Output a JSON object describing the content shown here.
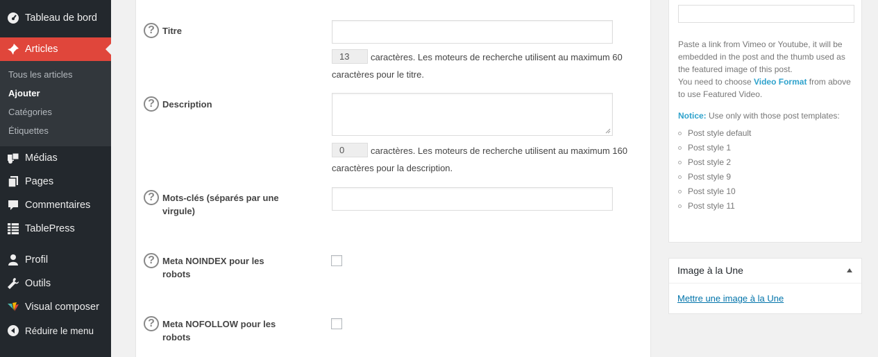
{
  "sidebar": {
    "menu": [
      {
        "label": "Tableau de bord",
        "icon": "dashboard-icon"
      },
      {
        "label": "Articles",
        "icon": "pushpin-icon"
      },
      {
        "label": "Médias",
        "icon": "media-icon"
      },
      {
        "label": "Pages",
        "icon": "pages-icon"
      },
      {
        "label": "Commentaires",
        "icon": "comment-icon"
      },
      {
        "label": "TablePress",
        "icon": "table-icon"
      },
      {
        "label": "Profil",
        "icon": "user-icon"
      },
      {
        "label": "Outils",
        "icon": "wrench-icon"
      },
      {
        "label": "Visual composer",
        "icon": "visual-composer-icon"
      }
    ],
    "submenu": [
      "Tous les articles",
      "Ajouter",
      "Catégories",
      "Étiquettes"
    ],
    "collapse_label": "Réduire le menu"
  },
  "seo": {
    "title": {
      "label": "Titre",
      "value": "",
      "count": "13",
      "help": "caractères. Les moteurs de recherche utilisent au maximum 60 caractères pour le titre."
    },
    "description": {
      "label": "Description",
      "value": "",
      "count": "0",
      "help": "caractères. Les moteurs de recherche utilisent au maximum 160 caractères pour la description."
    },
    "keywords": {
      "label": "Mots-clés (séparés par une virgule)",
      "value": ""
    },
    "noindex": {
      "label": "Meta NOINDEX pour les robots",
      "checked": false
    },
    "nofollow": {
      "label": "Meta NOFOLLOW pour les robots",
      "checked": false
    },
    "help_glyph": "?"
  },
  "featured_video": {
    "input_value": "",
    "paste_text": "Paste a link from Vimeo or Youtube, it will be embedded in the post and the thumb used as the featured image of this post.",
    "need_prefix": "You need to choose ",
    "need_format": "Video Format",
    "need_suffix": " from above to use Featured Video.",
    "notice_label": "Notice:",
    "notice_text": " Use only with those post templates:",
    "styles": [
      "Post style default",
      "Post style 1",
      "Post style 2",
      "Post style 9",
      "Post style 10",
      "Post style 11"
    ]
  },
  "featured_image": {
    "title": "Image à la Une",
    "link": "Mettre une image à la Une"
  },
  "colors": {
    "sidebar_bg": "#23282d",
    "active": "#e0463b",
    "link": "#0073aa",
    "notice": "#2ea2cc"
  }
}
